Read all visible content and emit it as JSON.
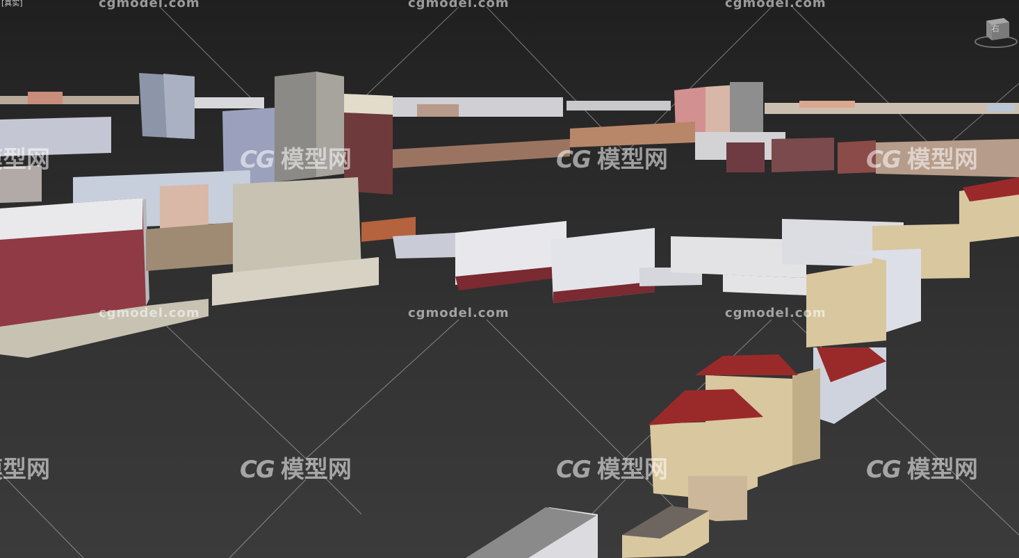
{
  "viewport": {
    "label": "[真实]",
    "background": "#2f2f2f"
  },
  "viewcube": {
    "face_label": "右",
    "icon": "viewcube-icon"
  },
  "watermarks": {
    "site_text": "cgmodel.com",
    "logo_mark": "CG",
    "logo_text": "模型网",
    "color": "rgba(255,255,255,0.55)"
  },
  "palette": {
    "roof_red": "#9a2a2a",
    "facade_beige": "#d9c7a0",
    "facade_white": "#e8e8ec",
    "facade_grey": "#8c8a86",
    "facade_maroon": "#6e3a3c"
  }
}
